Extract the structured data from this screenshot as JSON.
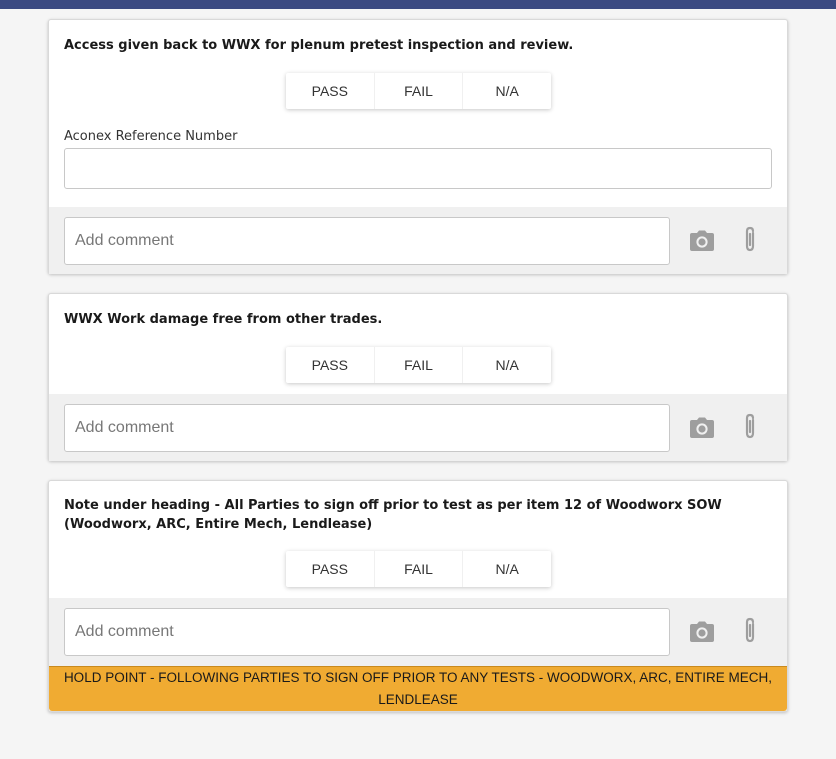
{
  "colors": {
    "topbar": "#3b4a82",
    "hold_banner": "#f0ab32",
    "icon_grey": "#9e9e9e"
  },
  "options": [
    "PASS",
    "FAIL",
    "N/A"
  ],
  "comment_placeholder": "Add comment",
  "items": [
    {
      "title": "Access given back to WWX for plenum pretest inspection and review.",
      "field_label": "Aconex Reference Number",
      "field_value": ""
    },
    {
      "title": "WWX Work damage free from other trades."
    },
    {
      "title": "Note under heading - All Parties to sign off prior to test as per item 12 of Woodworx SOW (Woodworx, ARC, Entire Mech, Lendlease)",
      "banner": "HOLD POINT - FOLLOWING PARTIES TO SIGN OFF PRIOR TO ANY TESTS - WOODWORX, ARC, ENTIRE MECH, LENDLEASE"
    }
  ],
  "icons": {
    "camera": "camera-icon",
    "attach": "paperclip-icon"
  }
}
